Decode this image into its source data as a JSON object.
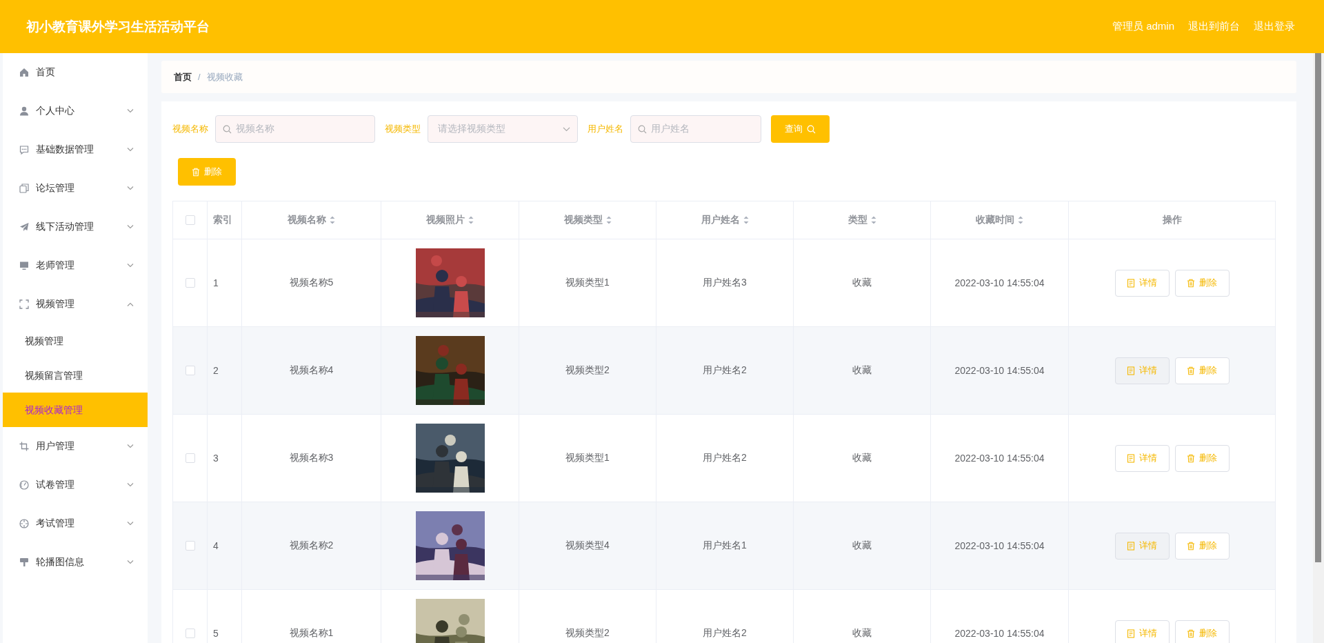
{
  "header": {
    "title": "初小教育课外学习生活活动平台",
    "user": "管理员 admin",
    "links": [
      "退出到前台",
      "退出登录"
    ]
  },
  "sidebar": {
    "items": [
      {
        "label": "首页",
        "kind": "link"
      },
      {
        "label": "个人中心",
        "kind": "group",
        "expanded": false
      },
      {
        "label": "基础数据管理",
        "kind": "group",
        "expanded": false
      },
      {
        "label": "论坛管理",
        "kind": "group",
        "expanded": false
      },
      {
        "label": "线下活动管理",
        "kind": "group",
        "expanded": false
      },
      {
        "label": "老师管理",
        "kind": "group",
        "expanded": false
      },
      {
        "label": "视频管理",
        "kind": "group",
        "expanded": true,
        "children": [
          {
            "label": "视频管理",
            "selected": false
          },
          {
            "label": "视频留言管理",
            "selected": false
          },
          {
            "label": "视频收藏管理",
            "selected": true
          }
        ]
      },
      {
        "label": "用户管理",
        "kind": "group",
        "expanded": false
      },
      {
        "label": "试卷管理",
        "kind": "group",
        "expanded": false
      },
      {
        "label": "考试管理",
        "kind": "group",
        "expanded": false
      },
      {
        "label": "轮播图信息",
        "kind": "group",
        "expanded": false
      }
    ]
  },
  "breadcrumb": {
    "items": [
      "首页",
      "视频收藏"
    ],
    "separator": "/"
  },
  "search": {
    "fields": [
      {
        "label": "视频名称",
        "placeholder": "视频名称",
        "kind": "text"
      },
      {
        "label": "视频类型",
        "placeholder": "请选择视频类型",
        "kind": "select"
      },
      {
        "label": "用户姓名",
        "placeholder": "用户姓名",
        "kind": "text"
      }
    ],
    "button": "查询"
  },
  "toolbar": {
    "delete_button": "删除"
  },
  "table": {
    "select_all": {
      "checked": false
    },
    "columns": [
      {
        "label": "索引",
        "sortable": false
      },
      {
        "label": "视频名称",
        "sortable": true
      },
      {
        "label": "视频照片",
        "sortable": true
      },
      {
        "label": "视频类型",
        "sortable": true
      },
      {
        "label": "用户姓名",
        "sortable": true
      },
      {
        "label": "类型",
        "sortable": true
      },
      {
        "label": "收藏时间",
        "sortable": true
      },
      {
        "label": "操作",
        "sortable": false
      }
    ],
    "rows": [
      {
        "checked": false,
        "index": "1",
        "name": "视频名称5",
        "photo": {
          "kind": "picture"
        },
        "video_type": "视频类型1",
        "user": "用户姓名3",
        "type": "收藏",
        "time": "2022-03-10 14:55:04",
        "actions": [
          "详情",
          "删除"
        ]
      },
      {
        "checked": false,
        "index": "2",
        "name": "视频名称4",
        "photo": {
          "kind": "picture"
        },
        "video_type": "视频类型2",
        "user": "用户姓名2",
        "type": "收藏",
        "time": "2022-03-10 14:55:04",
        "actions": [
          "详情",
          "删除"
        ]
      },
      {
        "checked": false,
        "index": "3",
        "name": "视频名称3",
        "photo": {
          "kind": "picture"
        },
        "video_type": "视频类型1",
        "user": "用户姓名2",
        "type": "收藏",
        "time": "2022-03-10 14:55:04",
        "actions": [
          "详情",
          "删除"
        ]
      },
      {
        "checked": false,
        "index": "4",
        "name": "视频名称2",
        "photo": {
          "kind": "picture"
        },
        "video_type": "视频类型4",
        "user": "用户姓名1",
        "type": "收藏",
        "time": "2022-03-10 14:55:04",
        "actions": [
          "详情",
          "删除"
        ]
      },
      {
        "checked": false,
        "index": "5",
        "name": "视频名称1",
        "photo": {
          "kind": "picture"
        },
        "video_type": "视频类型2",
        "user": "用户姓名2",
        "type": "收藏",
        "time": "2022-03-10 14:55:04",
        "actions": [
          "详情",
          "删除"
        ]
      }
    ]
  }
}
